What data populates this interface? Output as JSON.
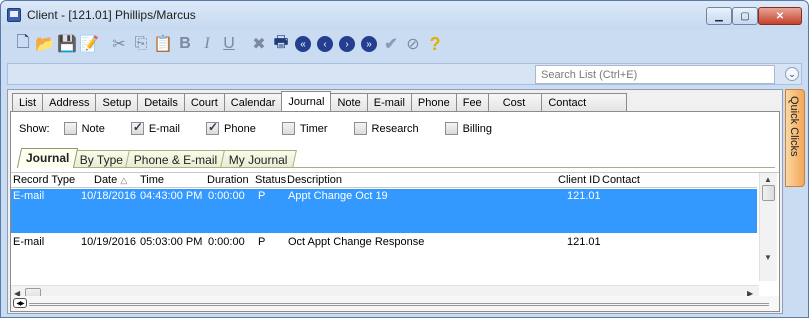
{
  "window": {
    "title": "Client - [121.01] Phillips/Marcus"
  },
  "toolbar": {
    "icons": [
      "new-doc-icon",
      "open-folder-icon",
      "save-icon",
      "note-icon",
      "cut-icon",
      "copy-icon",
      "paste-icon",
      "bold-icon",
      "italic-icon",
      "underline-icon",
      "delete-icon",
      "print-icon",
      "first-record-icon",
      "prev-record-icon",
      "next-record-icon",
      "last-record-icon",
      "check-icon",
      "cancel-icon",
      "help-icon"
    ]
  },
  "search": {
    "placeholder": "Search List (Ctrl+E)"
  },
  "tabs": [
    "List",
    "Address",
    "Setup",
    "Details",
    "Court",
    "Calendar",
    "Journal",
    "Note",
    "E-mail",
    "Phone",
    "Fee",
    "Cost",
    "Contact"
  ],
  "selected_tab": "Journal",
  "show": {
    "label": "Show:",
    "options": [
      {
        "label": "Note",
        "checked": false
      },
      {
        "label": "E-mail",
        "checked": true
      },
      {
        "label": "Phone",
        "checked": true
      },
      {
        "label": "Timer",
        "checked": false
      },
      {
        "label": "Research",
        "checked": false
      },
      {
        "label": "Billing",
        "checked": false
      }
    ]
  },
  "subtabs": [
    "Journal",
    "By Type",
    "Phone & E-mail",
    "My Journal"
  ],
  "grid": {
    "headers": [
      "Record Type",
      "Date",
      "Time",
      "Duration",
      "Status",
      "Description",
      "Client ID",
      "Contact"
    ],
    "rows": [
      {
        "type": "E-mail",
        "date": "10/18/2016",
        "time": "04:43:00 PM",
        "duration": "0:00:00",
        "status": "P",
        "description": "Appt Change Oct 19",
        "client_id": "121.01",
        "contact": "",
        "selected": true
      },
      {
        "type": "E-mail",
        "date": "10/19/2016",
        "time": "05:03:00 PM",
        "duration": "0:00:00",
        "status": "P",
        "description": "Oct Appt Change Response",
        "client_id": "121.01",
        "contact": "",
        "selected": false
      }
    ]
  },
  "quick_clicks": {
    "label": "Quick Clicks"
  },
  "colors": {
    "selection": "#3399ff",
    "quick_clicks": "#f3a65a",
    "title_bar": "#c6d9f0"
  }
}
